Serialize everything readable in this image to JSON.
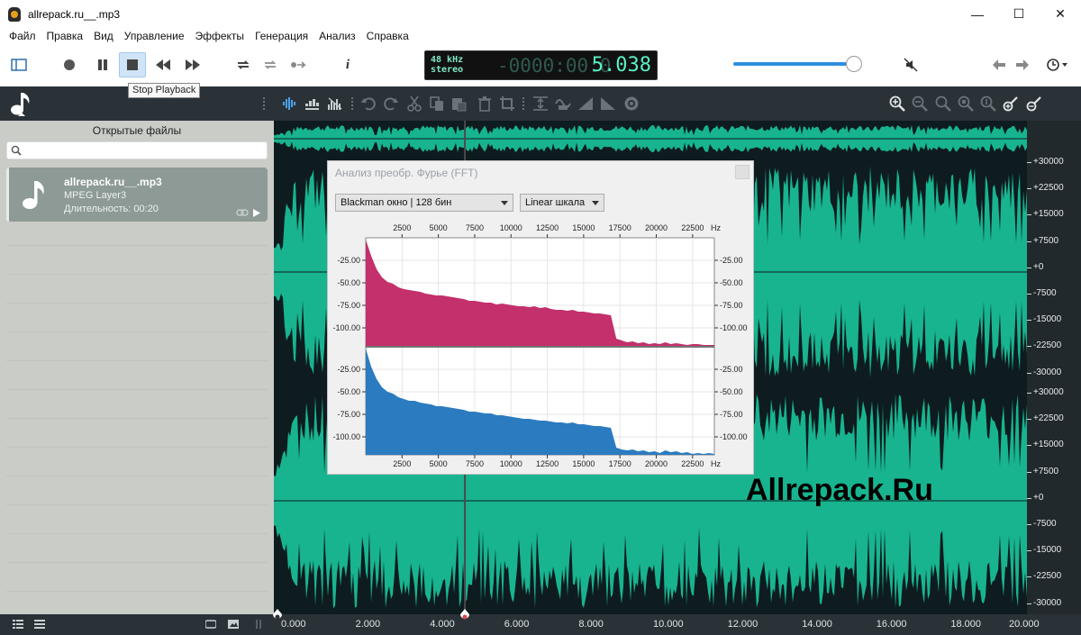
{
  "window": {
    "title": "allrepack.ru__.mp3",
    "minimize_glyph": "—",
    "maximize_glyph": "☐",
    "close_glyph": "✕"
  },
  "menu": [
    "Файл",
    "Правка",
    "Вид",
    "Управление",
    "Эффекты",
    "Генерация",
    "Анализ",
    "Справка"
  ],
  "transport": {
    "tooltip": "Stop Playback",
    "info_glyph": "i",
    "sample_rate": "48 kHz",
    "channels": "stereo",
    "time_dim": "-0000:00:0",
    "time_value": "5.038",
    "volume": 0.93
  },
  "sidebar": {
    "title": "Открытые файлы",
    "search_placeholder": "",
    "file": {
      "name": "allrepack.ru__.mp3",
      "format": "MPEG Layer3",
      "duration": "Длительность: 00:20"
    }
  },
  "watermark": "Allrepack.Ru",
  "ruler_labels": [
    "+30000",
    "+22500",
    "+15000",
    "+7500",
    "+0",
    "-7500",
    "-15000",
    "-22500",
    "-30000",
    "+30000",
    "+22500",
    "+15000",
    "+7500",
    "+0",
    "-7500",
    "-15000",
    "-22500",
    "-30000"
  ],
  "timeline": {
    "labels": [
      "0.000",
      "2.000",
      "4.000",
      "6.000",
      "8.000",
      "10.000",
      "12.000",
      "14.000",
      "16.000",
      "18.000",
      "20.000"
    ],
    "cursor_seconds": 5.038
  },
  "fft": {
    "title": "Анализ преобр. Фурье (FFT)",
    "window_select": "Blackman окно | 128 бин",
    "scale_select": "Linear шкала"
  },
  "colors": {
    "waveform": "#17b48f",
    "fft_left": "#c3306b",
    "fft_right": "#2b7bc0",
    "accent": "#2f8fe0"
  },
  "chart_data": {
    "type": "area",
    "title": "",
    "x_unit": "Hz",
    "x_ticks": [
      2500,
      5000,
      7500,
      10000,
      12500,
      15000,
      17500,
      20000,
      22500
    ],
    "y_ticks": [
      -25.0,
      -50.0,
      -75.0,
      -100.0
    ],
    "x_range": [
      0,
      24000
    ],
    "y_range": [
      -120,
      0
    ],
    "x": [
      0,
      375,
      750,
      1125,
      1500,
      1875,
      2250,
      2625,
      3000,
      3375,
      3750,
      4125,
      4500,
      4875,
      5250,
      5625,
      6000,
      6375,
      6750,
      7125,
      7500,
      7875,
      8250,
      8625,
      9000,
      9375,
      9750,
      10125,
      10500,
      10875,
      11250,
      11625,
      12000,
      12375,
      12750,
      13125,
      13500,
      13875,
      14250,
      14625,
      15000,
      15375,
      15750,
      16125,
      16500,
      16875,
      17250,
      17625,
      18000,
      18375,
      18750,
      19125,
      19500,
      19875,
      20250,
      20625,
      21000,
      21375,
      21750,
      22125,
      22500,
      22875,
      23250,
      23625,
      24000
    ],
    "series": [
      {
        "channel": "left",
        "values": [
          -2,
          -20,
          -35,
          -44,
          -49,
          -51,
          -55,
          -57,
          -58,
          -59,
          -60,
          -62,
          -63,
          -64,
          -64,
          -65,
          -66,
          -67,
          -68,
          -70,
          -70,
          -71,
          -72,
          -72,
          -74,
          -73,
          -74,
          -75,
          -76,
          -76,
          -77,
          -76,
          -78,
          -77,
          -79,
          -80,
          -80,
          -81,
          -80,
          -82,
          -82,
          -83,
          -84,
          -84,
          -85,
          -86,
          -112,
          -114,
          -116,
          -115,
          -117,
          -116,
          -118,
          -117,
          -118,
          -116,
          -118,
          -117,
          -118,
          -119,
          -118,
          -118,
          -119,
          -119,
          -119
        ]
      },
      {
        "channel": "right",
        "values": [
          -2,
          -22,
          -36,
          -45,
          -50,
          -52,
          -56,
          -58,
          -60,
          -60,
          -62,
          -63,
          -64,
          -66,
          -66,
          -67,
          -68,
          -69,
          -70,
          -72,
          -72,
          -73,
          -74,
          -74,
          -76,
          -76,
          -77,
          -78,
          -79,
          -80,
          -80,
          -81,
          -82,
          -82,
          -83,
          -84,
          -84,
          -85,
          -84,
          -86,
          -86,
          -87,
          -88,
          -88,
          -89,
          -90,
          -112,
          -114,
          -115,
          -114,
          -116,
          -115,
          -117,
          -116,
          -118,
          -115,
          -117,
          -116,
          -118,
          -117,
          -119,
          -118,
          -119,
          -118,
          -119
        ]
      }
    ]
  }
}
